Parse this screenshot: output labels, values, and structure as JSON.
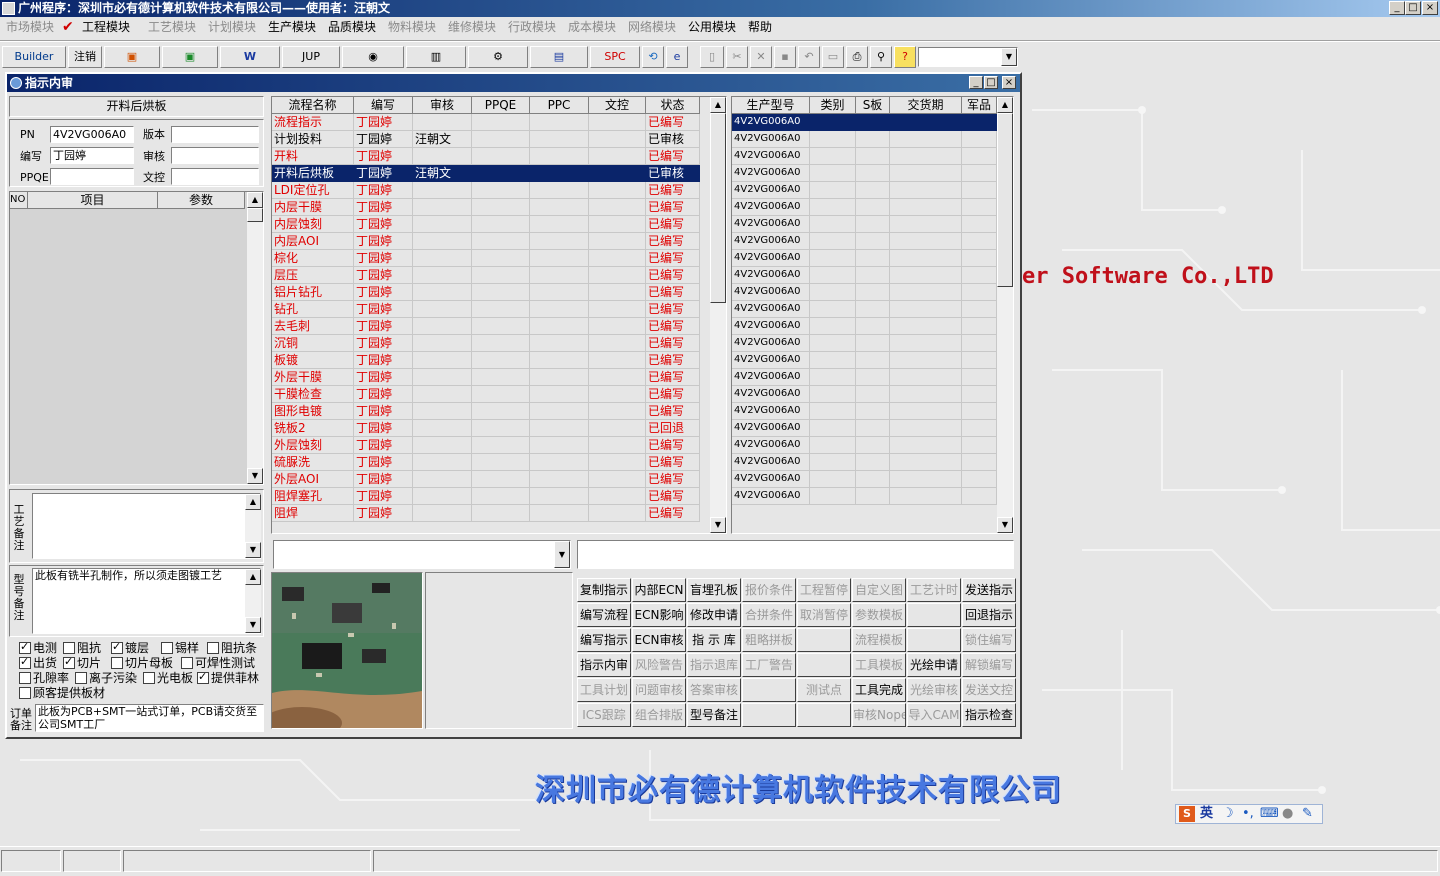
{
  "window": {
    "title": "广州程序：深圳市必有德计算机软件技术有限公司——使用者：汪朝文",
    "btn_min": "_",
    "btn_max": "□",
    "btn_close": "×"
  },
  "menu": [
    {
      "label": "市场模块",
      "dis": true
    },
    {
      "label": "工程模块",
      "dis": false
    },
    {
      "label": "工艺模块",
      "dis": true
    },
    {
      "label": "计划模块",
      "dis": true
    },
    {
      "label": "生产模块",
      "dis": false
    },
    {
      "label": "品质模块",
      "dis": false
    },
    {
      "label": "物料模块",
      "dis": true
    },
    {
      "label": "维修模块",
      "dis": true
    },
    {
      "label": "行政模块",
      "dis": true
    },
    {
      "label": "成本模块",
      "dis": true
    },
    {
      "label": "网络模块",
      "dis": true
    },
    {
      "label": "公用模块",
      "dis": false
    },
    {
      "label": "帮助",
      "dis": false
    }
  ],
  "toolbar": {
    "builder": "Builder",
    "logout": "注销",
    "jup": "JUP",
    "spc": "SPC"
  },
  "child": {
    "title": "指示内审"
  },
  "left": {
    "heading": "开料后烘板",
    "pn_label": "PN",
    "pn_value": "4V2VG006A0",
    "version_label": "版本",
    "version_value": "",
    "author_label": "编写",
    "author_value": "丁园婷",
    "review_label": "审核",
    "review_value": "",
    "ppqe_label": "PPQE",
    "ppqe_value": "",
    "doccontrol_label": "文控",
    "doccontrol_value": "",
    "param_headers": [
      "NO",
      "项目",
      "参数"
    ],
    "process_note_label": "工艺备注",
    "model_note_label": "型号备注",
    "model_note": "此板有铣半孔制作，所以须走图镀工艺",
    "order_note_label": "订单备注",
    "order_note": "此板为PCB+SMT一站式订单，PCB请交货至公司SMT工厂"
  },
  "checkboxes": [
    {
      "label": "电测",
      "on": true
    },
    {
      "label": "阻抗",
      "on": false
    },
    {
      "label": "镀层",
      "on": true
    },
    {
      "label": "锡样",
      "on": false
    },
    {
      "label": "阻抗条",
      "on": false
    },
    {
      "label": "出货",
      "on": true
    },
    {
      "label": "切片",
      "on": true
    },
    {
      "label": "切片母板",
      "on": false
    },
    {
      "label": "可焊性测试",
      "on": false
    },
    {
      "label": "孔隙率",
      "on": false
    },
    {
      "label": "离子污染",
      "on": false
    },
    {
      "label": "光电板",
      "on": false
    },
    {
      "label": "提供菲林",
      "on": true
    },
    {
      "label": "顾客提供板材",
      "on": false
    }
  ],
  "flow": {
    "headers": [
      "流程名称",
      "编写",
      "审核",
      "PPQE",
      "PPC",
      "文控",
      "状态"
    ],
    "rows": [
      {
        "name": "流程指示",
        "author": "丁园婷",
        "review": "",
        "status": "已编写",
        "red": true,
        "sel": false
      },
      {
        "name": "计划投料",
        "author": "丁园婷",
        "review": "汪朝文",
        "status": "已审核",
        "red": false,
        "sel": false
      },
      {
        "name": "开料",
        "author": "丁园婷",
        "review": "",
        "status": "已编写",
        "red": true,
        "sel": false
      },
      {
        "name": "开料后烘板",
        "author": "丁园婷",
        "review": "汪朝文",
        "status": "已审核",
        "red": false,
        "sel": true
      },
      {
        "name": "LDI定位孔",
        "author": "丁园婷",
        "review": "",
        "status": "已编写",
        "red": true,
        "sel": false
      },
      {
        "name": "内层干膜",
        "author": "丁园婷",
        "review": "",
        "status": "已编写",
        "red": true,
        "sel": false
      },
      {
        "name": "内层蚀刻",
        "author": "丁园婷",
        "review": "",
        "status": "已编写",
        "red": true,
        "sel": false
      },
      {
        "name": "内层AOI",
        "author": "丁园婷",
        "review": "",
        "status": "已编写",
        "red": true,
        "sel": false
      },
      {
        "name": "棕化",
        "author": "丁园婷",
        "review": "",
        "status": "已编写",
        "red": true,
        "sel": false
      },
      {
        "name": "层压",
        "author": "丁园婷",
        "review": "",
        "status": "已编写",
        "red": true,
        "sel": false
      },
      {
        "name": "铝片钻孔",
        "author": "丁园婷",
        "review": "",
        "status": "已编写",
        "red": true,
        "sel": false
      },
      {
        "name": "钻孔",
        "author": "丁园婷",
        "review": "",
        "status": "已编写",
        "red": true,
        "sel": false
      },
      {
        "name": "去毛刺",
        "author": "丁园婷",
        "review": "",
        "status": "已编写",
        "red": true,
        "sel": false
      },
      {
        "name": "沉铜",
        "author": "丁园婷",
        "review": "",
        "status": "已编写",
        "red": true,
        "sel": false
      },
      {
        "name": "板镀",
        "author": "丁园婷",
        "review": "",
        "status": "已编写",
        "red": true,
        "sel": false
      },
      {
        "name": "外层干膜",
        "author": "丁园婷",
        "review": "",
        "status": "已编写",
        "red": true,
        "sel": false
      },
      {
        "name": "干膜检查",
        "author": "丁园婷",
        "review": "",
        "status": "已编写",
        "red": true,
        "sel": false
      },
      {
        "name": "图形电镀",
        "author": "丁园婷",
        "review": "",
        "status": "已编写",
        "red": true,
        "sel": false
      },
      {
        "name": "铣板2",
        "author": "丁园婷",
        "review": "",
        "status": "已回退",
        "red": true,
        "sel": false
      },
      {
        "name": "外层蚀刻",
        "author": "丁园婷",
        "review": "",
        "status": "已编写",
        "red": true,
        "sel": false
      },
      {
        "name": "硫脲洗",
        "author": "丁园婷",
        "review": "",
        "status": "已编写",
        "red": true,
        "sel": false
      },
      {
        "name": "外层AOI",
        "author": "丁园婷",
        "review": "",
        "status": "已编写",
        "red": true,
        "sel": false
      },
      {
        "name": "阻焊塞孔",
        "author": "丁园婷",
        "review": "",
        "status": "已编写",
        "red": true,
        "sel": false
      },
      {
        "name": "阻焊",
        "author": "丁园婷",
        "review": "",
        "status": "已编写",
        "red": true,
        "sel": false
      }
    ]
  },
  "models": {
    "headers": [
      "生产型号",
      "类别",
      "S板",
      "交货期",
      "军品"
    ],
    "rows": [
      "4V2VG006A0",
      "4V2VG006A0",
      "4V2VG006A0",
      "4V2VG006A0",
      "4V2VG006A0",
      "4V2VG006A0",
      "4V2VG006A0",
      "4V2VG006A0",
      "4V2VG006A0",
      "4V2VG006A0",
      "4V2VG006A0",
      "4V2VG006A0",
      "4V2VG006A0",
      "4V2VG006A0",
      "4V2VG006A0",
      "4V2VG006A0",
      "4V2VG006A0",
      "4V2VG006A0",
      "4V2VG006A0",
      "4V2VG006A0",
      "4V2VG006A0",
      "4V2VG006A0",
      "4V2VG006A0"
    ]
  },
  "buttons": [
    [
      {
        "l": "复制指示",
        "d": false
      },
      {
        "l": "内部ECN",
        "d": false
      },
      {
        "l": "盲埋孔板",
        "d": false
      },
      {
        "l": "报价条件",
        "d": true
      },
      {
        "l": "工程暂停",
        "d": true
      },
      {
        "l": "自定义图",
        "d": true
      },
      {
        "l": "工艺计时",
        "d": true
      },
      {
        "l": "发送指示",
        "d": false
      }
    ],
    [
      {
        "l": "编写流程",
        "d": false
      },
      {
        "l": "ECN影响",
        "d": false
      },
      {
        "l": "修改申请",
        "d": false
      },
      {
        "l": "合拼条件",
        "d": true
      },
      {
        "l": "取消暂停",
        "d": true
      },
      {
        "l": "参数模板",
        "d": true
      },
      {
        "l": "",
        "d": true
      },
      {
        "l": "回退指示",
        "d": false
      }
    ],
    [
      {
        "l": "编写指示",
        "d": false
      },
      {
        "l": "ECN审核",
        "d": false
      },
      {
        "l": "指 示 库",
        "d": false
      },
      {
        "l": "粗略拼板",
        "d": true
      },
      {
        "l": "",
        "d": true
      },
      {
        "l": "流程模板",
        "d": true
      },
      {
        "l": "",
        "d": true
      },
      {
        "l": "锁住编写",
        "d": true
      }
    ],
    [
      {
        "l": "指示内审",
        "d": false
      },
      {
        "l": "风险警告",
        "d": true
      },
      {
        "l": "指示退库",
        "d": true
      },
      {
        "l": "工厂警告",
        "d": true
      },
      {
        "l": "",
        "d": true
      },
      {
        "l": "工具模板",
        "d": true
      },
      {
        "l": "光绘申请",
        "d": false
      },
      {
        "l": "解锁编写",
        "d": true
      }
    ],
    [
      {
        "l": "工具计划",
        "d": true
      },
      {
        "l": "问题审核",
        "d": true
      },
      {
        "l": "答案审核",
        "d": true
      },
      {
        "l": "",
        "d": true
      },
      {
        "l": "测试点",
        "d": true
      },
      {
        "l": "工具完成",
        "d": false
      },
      {
        "l": "光绘审核",
        "d": true
      },
      {
        "l": "发送文控",
        "d": true
      }
    ],
    [
      {
        "l": "ICS跟踪",
        "d": true
      },
      {
        "l": "组合排版",
        "d": true
      },
      {
        "l": "型号备注",
        "d": false
      },
      {
        "l": "",
        "d": true
      },
      {
        "l": "",
        "d": true
      },
      {
        "l": "审核Nope",
        "d": true
      },
      {
        "l": "导入CAM",
        "d": true
      },
      {
        "l": "指示检查",
        "d": false
      }
    ]
  ],
  "background": {
    "company_en": "er Software Co.,LTD",
    "company_cn": "深圳市必有德计算机软件技术有限公司",
    "ime": {
      "logo": "S",
      "mode": "英"
    }
  },
  "colors": {
    "titlebar": "#0a246a",
    "selection": "#0a246a",
    "status_red": "#e00000",
    "brand_en": "#c0101a",
    "brand_cn": "#4878e0"
  }
}
